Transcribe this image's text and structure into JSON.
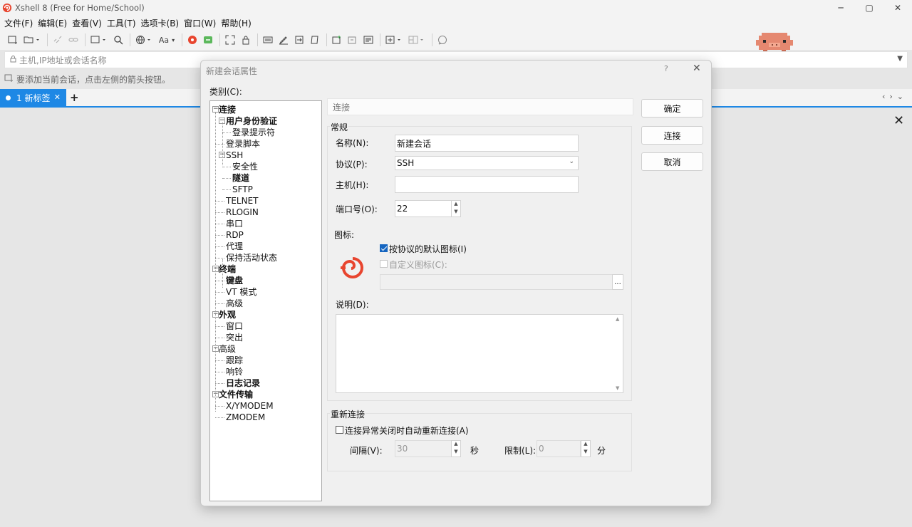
{
  "app": {
    "title": "Xshell 8 (Free for Home/School)",
    "window_controls": {
      "minimize": "─",
      "maximize": "▢",
      "close": "✕"
    }
  },
  "menu": [
    "文件(F)",
    "编辑(E)",
    "查看(V)",
    "工具(T)",
    "选项卡(B)",
    "窗口(W)",
    "帮助(H)"
  ],
  "toolbar": {
    "font_label": "Aa"
  },
  "address": {
    "placeholder": "主机,IP地址或会话名称"
  },
  "hint": "要添加当前会话，点击左侧的箭头按钮。",
  "tabs": [
    {
      "label": "1 新标签",
      "close": "✕"
    }
  ],
  "tab_add": "+",
  "dialog": {
    "title": "新建会话属性",
    "help": "?",
    "close": "✕",
    "category_label": "类别(C):",
    "tree": [
      {
        "label": "连接",
        "level": 0,
        "bold": true,
        "expand": "−"
      },
      {
        "label": "用户身份验证",
        "level": 1,
        "bold": true,
        "expand": "−"
      },
      {
        "label": "登录提示符",
        "level": 2,
        "bold": false
      },
      {
        "label": "登录脚本",
        "level": 1,
        "bold": false
      },
      {
        "label": "SSH",
        "level": 1,
        "bold": false,
        "expand": "−"
      },
      {
        "label": "安全性",
        "level": 2,
        "bold": false
      },
      {
        "label": "隧道",
        "level": 2,
        "bold": true
      },
      {
        "label": "SFTP",
        "level": 2,
        "bold": false
      },
      {
        "label": "TELNET",
        "level": 1,
        "bold": false
      },
      {
        "label": "RLOGIN",
        "level": 1,
        "bold": false
      },
      {
        "label": "串口",
        "level": 1,
        "bold": false
      },
      {
        "label": "RDP",
        "level": 1,
        "bold": false
      },
      {
        "label": "代理",
        "level": 1,
        "bold": false
      },
      {
        "label": "保持活动状态",
        "level": 1,
        "bold": false
      },
      {
        "label": "终端",
        "level": 0,
        "bold": true,
        "expand": "−"
      },
      {
        "label": "键盘",
        "level": 1,
        "bold": true
      },
      {
        "label": "VT 模式",
        "level": 1,
        "bold": false
      },
      {
        "label": "高级",
        "level": 1,
        "bold": false
      },
      {
        "label": "外观",
        "level": 0,
        "bold": true,
        "expand": "−"
      },
      {
        "label": "窗口",
        "level": 1,
        "bold": false
      },
      {
        "label": "突出",
        "level": 1,
        "bold": false
      },
      {
        "label": "高级",
        "level": 0,
        "bold": false,
        "expand": "−"
      },
      {
        "label": "跟踪",
        "level": 1,
        "bold": false
      },
      {
        "label": "响铃",
        "level": 1,
        "bold": false
      },
      {
        "label": "日志记录",
        "level": 1,
        "bold": true
      },
      {
        "label": "文件传输",
        "level": 0,
        "bold": true,
        "expand": "−"
      },
      {
        "label": "X/YMODEM",
        "level": 1,
        "bold": false
      },
      {
        "label": "ZMODEM",
        "level": 1,
        "bold": false
      }
    ],
    "section_header": "连接",
    "general": {
      "label": "常规",
      "name_label": "名称(N):",
      "name_value": "新建会话",
      "protocol_label": "协议(P):",
      "protocol_value": "SSH",
      "host_label": "主机(H):",
      "host_value": "",
      "port_label": "端口号(O):",
      "port_value": "22",
      "icon_label": "图标:",
      "default_icon_label": "按协议的默认图标(I)",
      "default_icon_checked": true,
      "custom_icon_label": "自定义图标(C):",
      "custom_icon_checked": false,
      "browse_label": "...",
      "desc_label": "说明(D):",
      "desc_value": ""
    },
    "reconnect": {
      "label": "重新连接",
      "auto_label": "连接异常关闭时自动重新连接(A)",
      "auto_checked": false,
      "interval_label": "间隔(V):",
      "interval_value": "30",
      "interval_unit": "秒",
      "limit_label": "限制(L):",
      "limit_value": "0",
      "limit_unit": "分"
    },
    "buttons": {
      "ok": "确定",
      "connect": "连接",
      "cancel": "取消"
    }
  },
  "colors": {
    "accent": "#1e88e5",
    "brand_red": "#e8452f",
    "checkbox_blue": "#1565c0"
  }
}
